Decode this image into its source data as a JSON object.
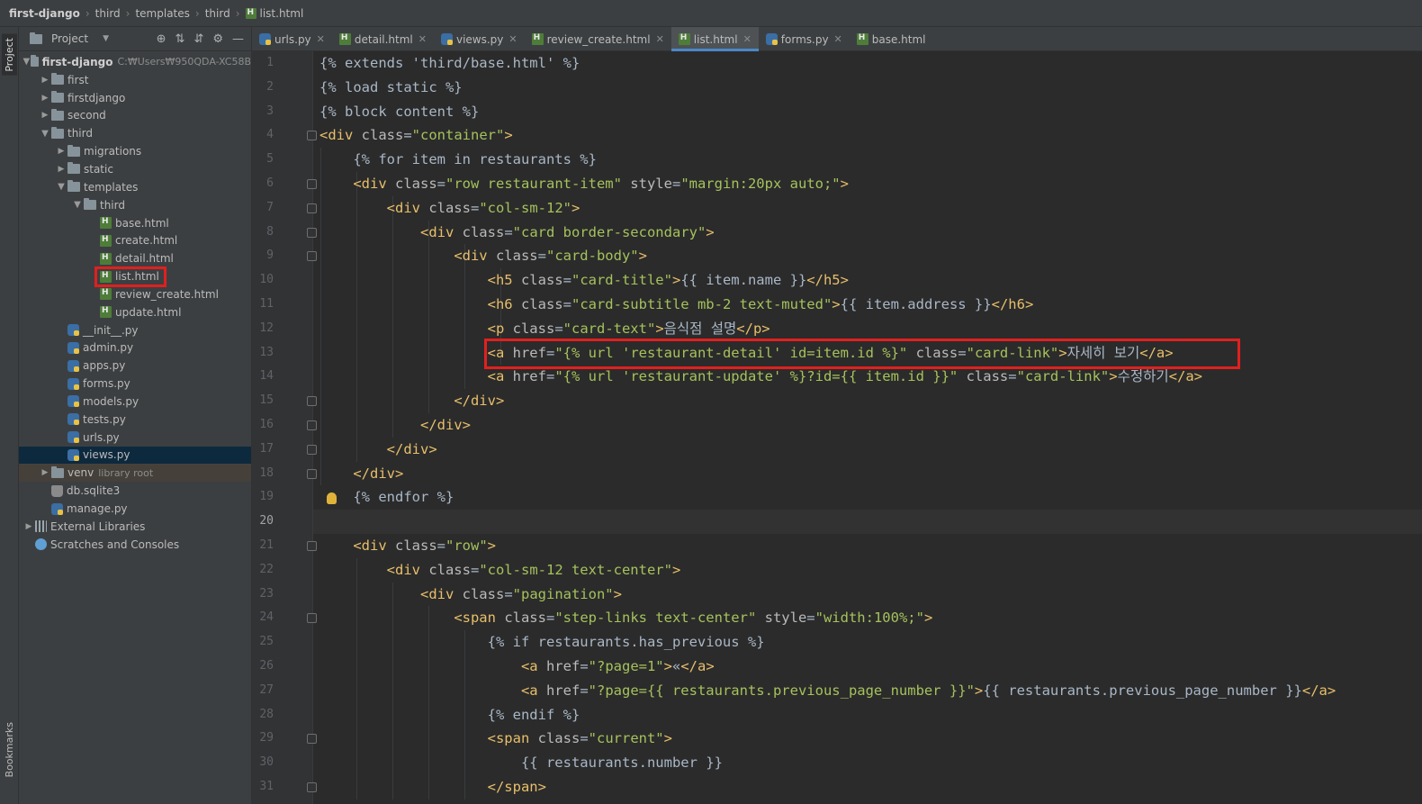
{
  "breadcrumb": [
    "first-django",
    "third",
    "templates",
    "third",
    "list.html"
  ],
  "sidebar": {
    "left_strip": {
      "project": "Project",
      "bookmarks": "Bookmarks"
    },
    "title": "Project",
    "root": {
      "name": "first-django",
      "hint": "C:₩Users₩950QDA-XC58B"
    },
    "items": [
      {
        "label": "first",
        "type": "folder",
        "depth": 1,
        "expanded": false
      },
      {
        "label": "firstdjango",
        "type": "folder",
        "depth": 1,
        "expanded": false
      },
      {
        "label": "second",
        "type": "folder",
        "depth": 1,
        "expanded": false
      },
      {
        "label": "third",
        "type": "folder",
        "depth": 1,
        "expanded": true
      },
      {
        "label": "migrations",
        "type": "folder",
        "depth": 2,
        "expanded": false
      },
      {
        "label": "static",
        "type": "folder",
        "depth": 2,
        "expanded": false
      },
      {
        "label": "templates",
        "type": "folder",
        "depth": 2,
        "expanded": true
      },
      {
        "label": "third",
        "type": "folder",
        "depth": 3,
        "expanded": true
      },
      {
        "label": "base.html",
        "type": "html",
        "depth": 4
      },
      {
        "label": "create.html",
        "type": "html",
        "depth": 4
      },
      {
        "label": "detail.html",
        "type": "html",
        "depth": 4
      },
      {
        "label": "list.html",
        "type": "html",
        "depth": 4,
        "highlighted": true
      },
      {
        "label": "review_create.html",
        "type": "html",
        "depth": 4
      },
      {
        "label": "update.html",
        "type": "html",
        "depth": 4
      },
      {
        "label": "__init__.py",
        "type": "py",
        "depth": 2
      },
      {
        "label": "admin.py",
        "type": "py",
        "depth": 2
      },
      {
        "label": "apps.py",
        "type": "py",
        "depth": 2
      },
      {
        "label": "forms.py",
        "type": "py",
        "depth": 2
      },
      {
        "label": "models.py",
        "type": "py",
        "depth": 2
      },
      {
        "label": "tests.py",
        "type": "py",
        "depth": 2
      },
      {
        "label": "urls.py",
        "type": "py",
        "depth": 2
      },
      {
        "label": "views.py",
        "type": "py",
        "depth": 2,
        "selected": true
      },
      {
        "label": "venv",
        "type": "folder",
        "depth": 1,
        "expanded": false,
        "hint": "library root"
      },
      {
        "label": "db.sqlite3",
        "type": "db",
        "depth": 1
      },
      {
        "label": "manage.py",
        "type": "py",
        "depth": 1
      },
      {
        "label": "External Libraries",
        "type": "lib",
        "depth": 0,
        "expanded": false
      },
      {
        "label": "Scratches and Consoles",
        "type": "scratch",
        "depth": 0
      }
    ]
  },
  "tabs": [
    {
      "label": "urls.py",
      "type": "py"
    },
    {
      "label": "detail.html",
      "type": "html"
    },
    {
      "label": "views.py",
      "type": "py"
    },
    {
      "label": "review_create.html",
      "type": "html"
    },
    {
      "label": "list.html",
      "type": "html",
      "active": true
    },
    {
      "label": "forms.py",
      "type": "py"
    },
    {
      "label": "base.html",
      "type": "html"
    }
  ],
  "editor": {
    "current_line": 20,
    "highlighted_line": 13,
    "lines": [
      "{% extends 'third/base.html' %}",
      "{% load static %}",
      "{% block content %}",
      "<div class=\"container\">",
      "    {% for item in restaurants %}",
      "    <div class=\"row restaurant-item\" style=\"margin:20px auto;\">",
      "        <div class=\"col-sm-12\">",
      "            <div class=\"card border-secondary\">",
      "                <div class=\"card-body\">",
      "                    <h5 class=\"card-title\">{{ item.name }}</h5>",
      "                    <h6 class=\"card-subtitle mb-2 text-muted\">{{ item.address }}</h6>",
      "                    <p class=\"card-text\">음식점 설명</p>",
      "                    <a href=\"{% url 'restaurant-detail' id=item.id %}\" class=\"card-link\">자세히 보기</a>",
      "                    <a href=\"{% url 'restaurant-update' %}?id={{ item.id }}\" class=\"card-link\">수정하기</a>",
      "                </div>",
      "            </div>",
      "        </div>",
      "    </div>",
      "    {% endfor %}",
      "",
      "    <div class=\"row\">",
      "        <div class=\"col-sm-12 text-center\">",
      "            <div class=\"pagination\">",
      "                <span class=\"step-links text-center\" style=\"width:100%;\">",
      "                    {% if restaurants.has_previous %}",
      "                        <a href=\"?page=1\">«</a>",
      "                        <a href=\"?page={{ restaurants.previous_page_number }}\">{{ restaurants.previous_page_number }}</a>",
      "                    {% endif %}",
      "                    <span class=\"current\">",
      "                        {{ restaurants.number }}",
      "                    </span>"
    ]
  },
  "colors": {
    "tag": "#e8bf6a",
    "attr": "#bababa",
    "string": "#a5c25c",
    "template": "#a9b7c6",
    "highlight_box": "#e0201f",
    "accent": "#4a88c7"
  }
}
